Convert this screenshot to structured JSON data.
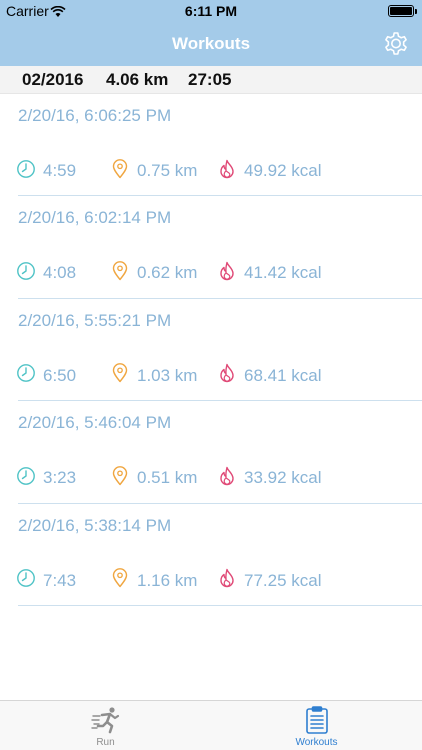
{
  "status_bar": {
    "carrier": "Carrier",
    "time": "6:11 PM",
    "battery_level": 1.0
  },
  "nav": {
    "title": "Workouts",
    "settings_icon": "gear-icon"
  },
  "summary": {
    "month": "02/2016",
    "distance": "4.06 km",
    "duration": "27:05"
  },
  "workouts": [
    {
      "date": "2/20/16, 6:06:25 PM",
      "duration": "4:59",
      "distance": "0.75 km",
      "calories": "49.92 kcal"
    },
    {
      "date": "2/20/16, 6:02:14 PM",
      "duration": "4:08",
      "distance": "0.62 km",
      "calories": "41.42 kcal"
    },
    {
      "date": "2/20/16, 5:55:21 PM",
      "duration": "6:50",
      "distance": "1.03 km",
      "calories": "68.41 kcal"
    },
    {
      "date": "2/20/16, 5:46:04 PM",
      "duration": "3:23",
      "distance": "0.51 km",
      "calories": "33.92 kcal"
    },
    {
      "date": "2/20/16, 5:38:14 PM",
      "duration": "7:43",
      "distance": "1.16 km",
      "calories": "77.25 kcal"
    }
  ],
  "tabs": [
    {
      "label": "Run",
      "icon": "runner-icon",
      "selected": false
    },
    {
      "label": "Workouts",
      "icon": "clipboard-icon",
      "selected": true
    }
  ],
  "colors": {
    "nav_background": "#a4cbe9",
    "date_text": "#8ab4d6",
    "clock_icon": "#4fc3c6",
    "pin_icon": "#f0a640",
    "flame_icon": "#e04a77",
    "tab_selected": "#2f7fd0"
  }
}
